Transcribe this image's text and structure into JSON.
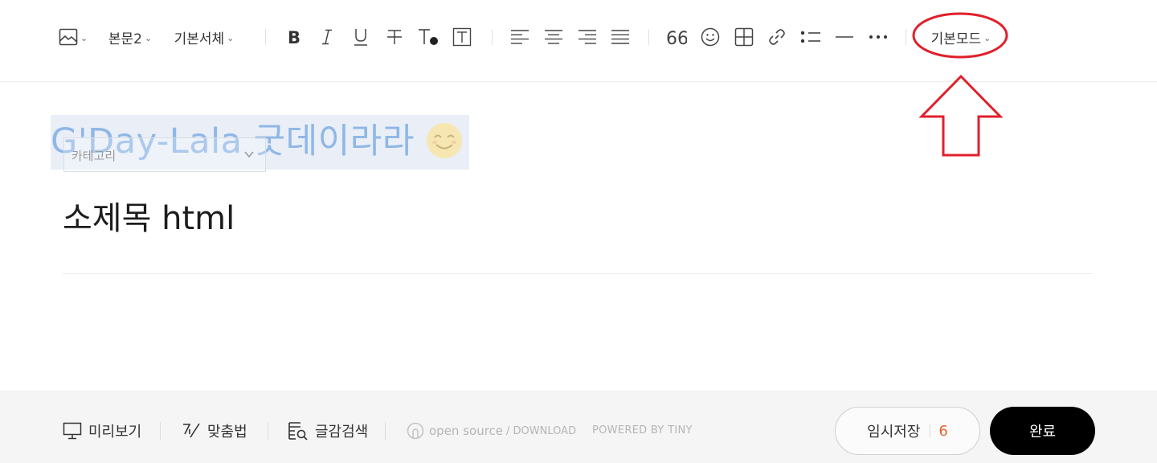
{
  "toolbar": {
    "image_icon": "image-icon",
    "paragraph_style": "본문2",
    "font_family": "기본서체",
    "mode": "기본모드",
    "format_icons": [
      "bold-icon",
      "italic-icon",
      "underline-icon",
      "strikethrough-icon",
      "text-color-icon",
      "text-background-icon"
    ],
    "align_icons": [
      "align-left-icon",
      "align-center-icon",
      "align-right-icon",
      "align-justify-icon"
    ],
    "insert_icons": [
      "quote-icon",
      "emoticon-icon",
      "table-icon",
      "link-icon",
      "list-icon",
      "horizontal-rule-icon",
      "more-icon"
    ]
  },
  "editor": {
    "title": "G'Day-Lala 굿데이라라",
    "category_label": "카테고리",
    "subtitle": "소제목 html"
  },
  "annotation": {
    "color": "#e0202b"
  },
  "footer": {
    "preview_label": "미리보기",
    "spellcheck_label": "맞춤법",
    "search_label": "글감검색",
    "open_source_label": "open source",
    "download_label": "/ DOWNLOAD",
    "powered_label": "POWERED BY TINY",
    "save_label": "임시저장",
    "save_count": "6",
    "done_label": "완료"
  },
  "colors": {
    "accent_count": "#e0662e",
    "done_button": "#000000",
    "title_text": "#8fb7e6",
    "title_highlight": "#e9eef7"
  }
}
